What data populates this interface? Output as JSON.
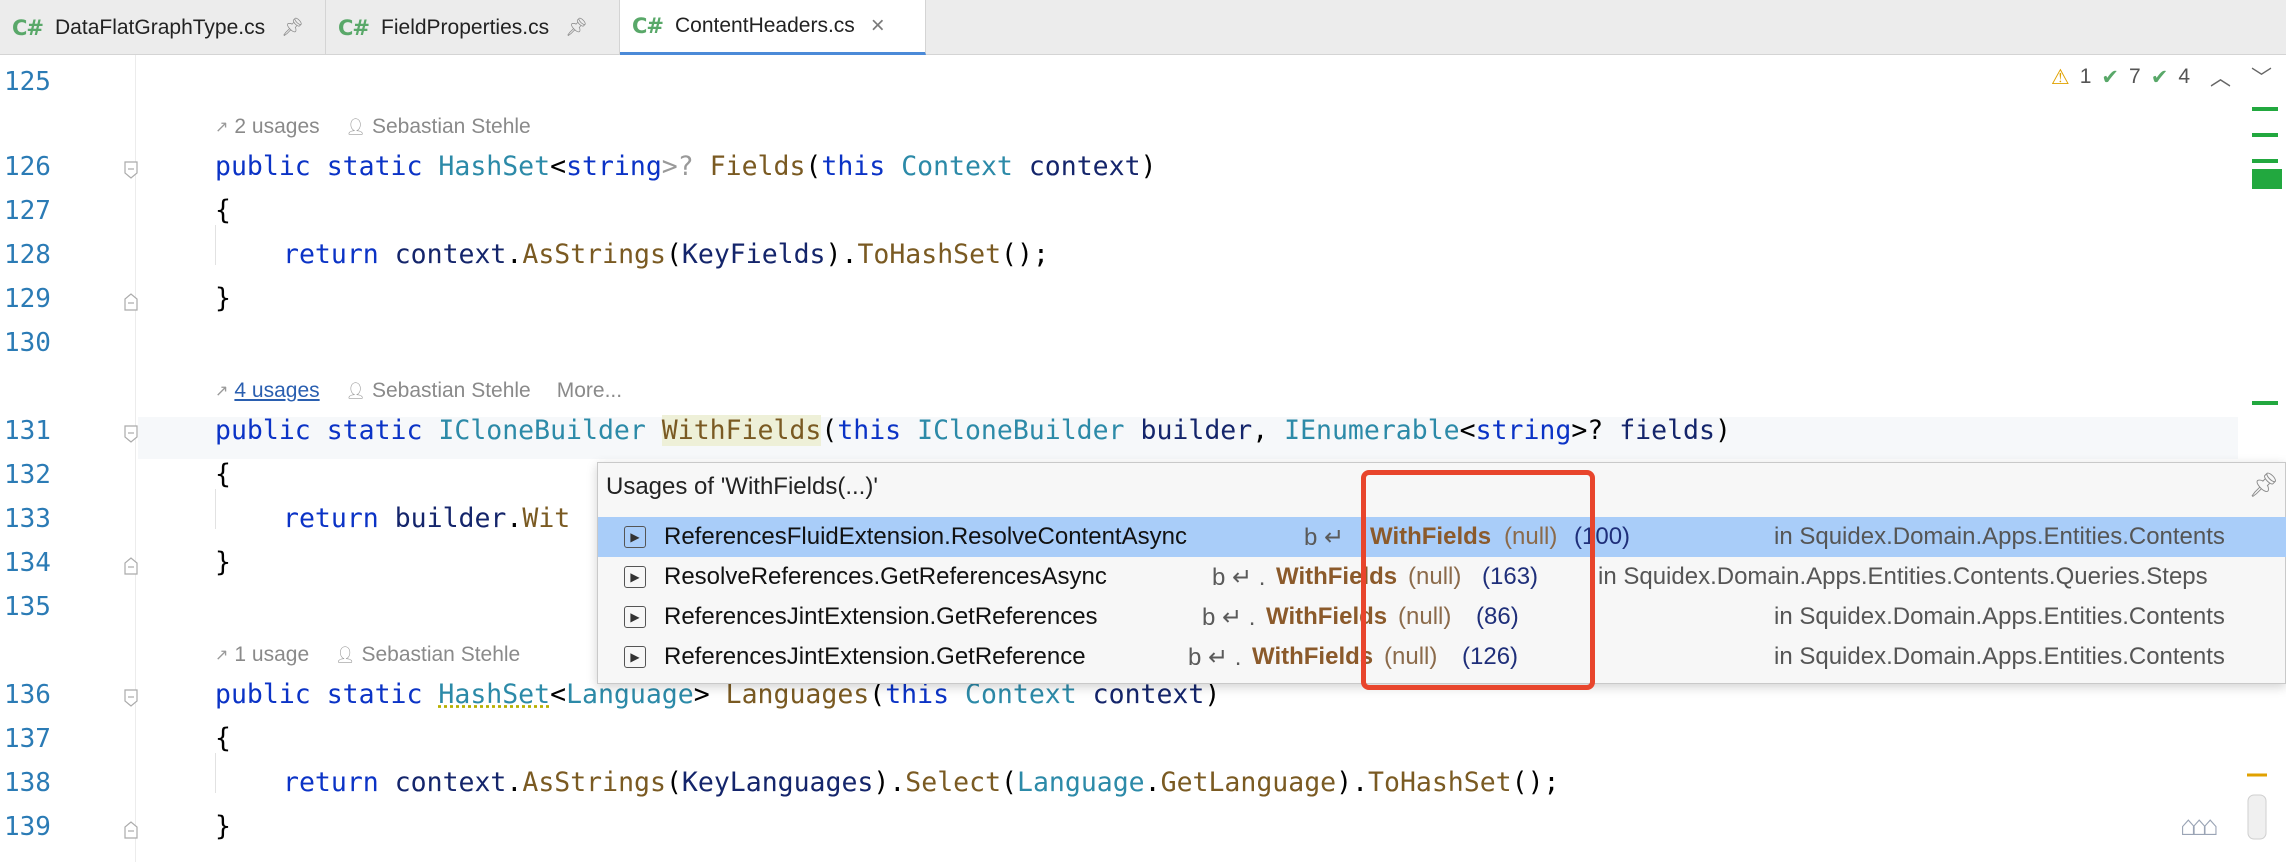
{
  "tabs": [
    {
      "badge": "C#",
      "label": "DataFlatGraphType.cs",
      "state": "pinned"
    },
    {
      "badge": "C#",
      "label": "FieldProperties.cs",
      "state": "pinned"
    },
    {
      "badge": "C#",
      "label": "ContentHeaders.cs",
      "state": "active"
    }
  ],
  "inspection": {
    "warnings": "1",
    "ok": "7",
    "typos": "4"
  },
  "lines": {
    "n125": "125",
    "n126": "126",
    "n127": "127",
    "n128": "128",
    "n129": "129",
    "n130": "130",
    "n131": "131",
    "n132": "132",
    "n133": "133",
    "n134": "134",
    "n135": "135",
    "n136": "136",
    "n137": "137",
    "n138": "138",
    "n139": "139"
  },
  "hints": {
    "h1": {
      "usages": "2 usages",
      "author": "Sebastian Stehle"
    },
    "h2": {
      "usages": "4 usages",
      "author": "Sebastian Stehle",
      "more": "More..."
    },
    "h3": {
      "usages": "1 usage",
      "author": "Sebastian Stehle"
    }
  },
  "code": {
    "l126": [
      "public",
      " ",
      "static",
      " ",
      "HashSet",
      "<",
      "string",
      ">?",
      " ",
      "Fields",
      "(",
      "this",
      " ",
      "Context",
      " ",
      "context",
      ")"
    ],
    "l127": "{",
    "l128": [
      "return",
      " ",
      "context",
      ".",
      "AsStrings",
      "(",
      "KeyFields",
      ").",
      "ToHashSet",
      "();"
    ],
    "l129": "}",
    "l131": [
      "public",
      " ",
      "static",
      " ",
      "ICloneBuilder",
      " ",
      "WithFields",
      "(",
      "this",
      " ",
      "ICloneBuilder",
      " ",
      "builder",
      ", ",
      "IEnumerable",
      "<",
      "string",
      ">?",
      " ",
      "fields",
      ")"
    ],
    "l132": "{",
    "l133": [
      "return",
      " ",
      "builder",
      ".",
      "Wit"
    ],
    "l134": "}",
    "l136": [
      "public",
      " ",
      "static",
      " ",
      "HashSet",
      "<",
      "Language",
      ">",
      " ",
      "Languages",
      "(",
      "this",
      " ",
      "Context",
      " ",
      "context",
      ")"
    ],
    "l137": "{",
    "l138": [
      "return",
      " ",
      "context",
      ".",
      "AsStrings",
      "(",
      "KeyLanguages",
      ").",
      "Select",
      "(",
      "Language",
      ".",
      "GetLanguage",
      ").",
      "ToHashSet",
      "();"
    ],
    "l139": "}"
  },
  "popup": {
    "title": "Usages of 'WithFields(...)'",
    "rows": [
      {
        "method": "ReferencesFluidExtension.ResolveContentAsync",
        "prefix": "b ↵ ",
        "call": "WithFields",
        "arg": "(null)",
        "line": "(100)",
        "location": "in Squidex.Domain.Apps.Entities.Contents",
        "selected": true
      },
      {
        "method": "ResolveReferences.GetReferencesAsync",
        "prefix": "b ↵ .",
        "call": "WithFields",
        "arg": "(null)",
        "line": "(163)",
        "location": "in Squidex.Domain.Apps.Entities.Contents.Queries.Steps",
        "selected": false
      },
      {
        "method": "ReferencesJintExtension.GetReferences",
        "prefix": "b ↵ .",
        "call": "WithFields",
        "arg": "(null)",
        "line": "(86)",
        "location": "in Squidex.Domain.Apps.Entities.Contents",
        "selected": false
      },
      {
        "method": "ReferencesJintExtension.GetReference",
        "prefix": "b ↵ .",
        "call": "WithFields",
        "arg": "(null)",
        "line": "(126)",
        "location": "in Squidex.Domain.Apps.Entities.Contents",
        "selected": false
      }
    ]
  },
  "colors": {
    "keyword": "#0b33c6",
    "type": "#2c8aa8",
    "method": "#7a5a22",
    "highlight_box": "#e8452c",
    "selection": "#a9cdf9"
  }
}
